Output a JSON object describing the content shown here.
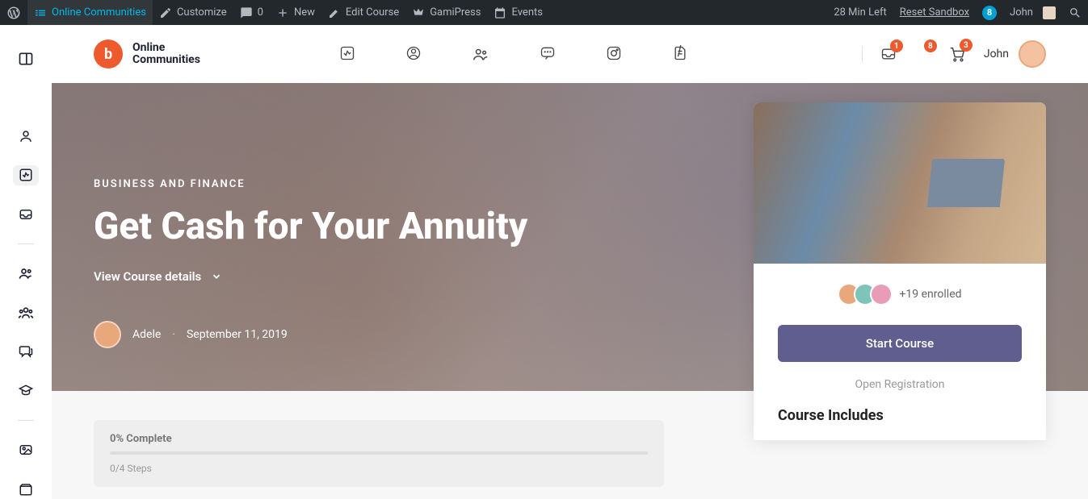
{
  "admin": {
    "site": "Online Communities",
    "customize": "Customize",
    "comments": "0",
    "new": "New",
    "edit": "Edit Course",
    "gami": "GamiPress",
    "events": "Events",
    "time_left": "28 Min Left",
    "reset": "Reset Sandbox",
    "badge": "8",
    "user": "John"
  },
  "header": {
    "brand_line1": "Online",
    "brand_line2": "Communities",
    "badges": {
      "inbox": "1",
      "bell": "8",
      "cart": "3"
    },
    "user": "John"
  },
  "hero": {
    "category": "BUSINESS AND FINANCE",
    "title": "Get Cash for Your Annuity",
    "view_details": "View Course details",
    "author": "Adele",
    "date": "September 11, 2019"
  },
  "sidebar": {
    "enrolled": "+19 enrolled",
    "start": "Start Course",
    "open_reg": "Open Registration",
    "includes": "Course Includes"
  },
  "progress": {
    "complete": "0% Complete",
    "steps": "0/4 Steps"
  }
}
